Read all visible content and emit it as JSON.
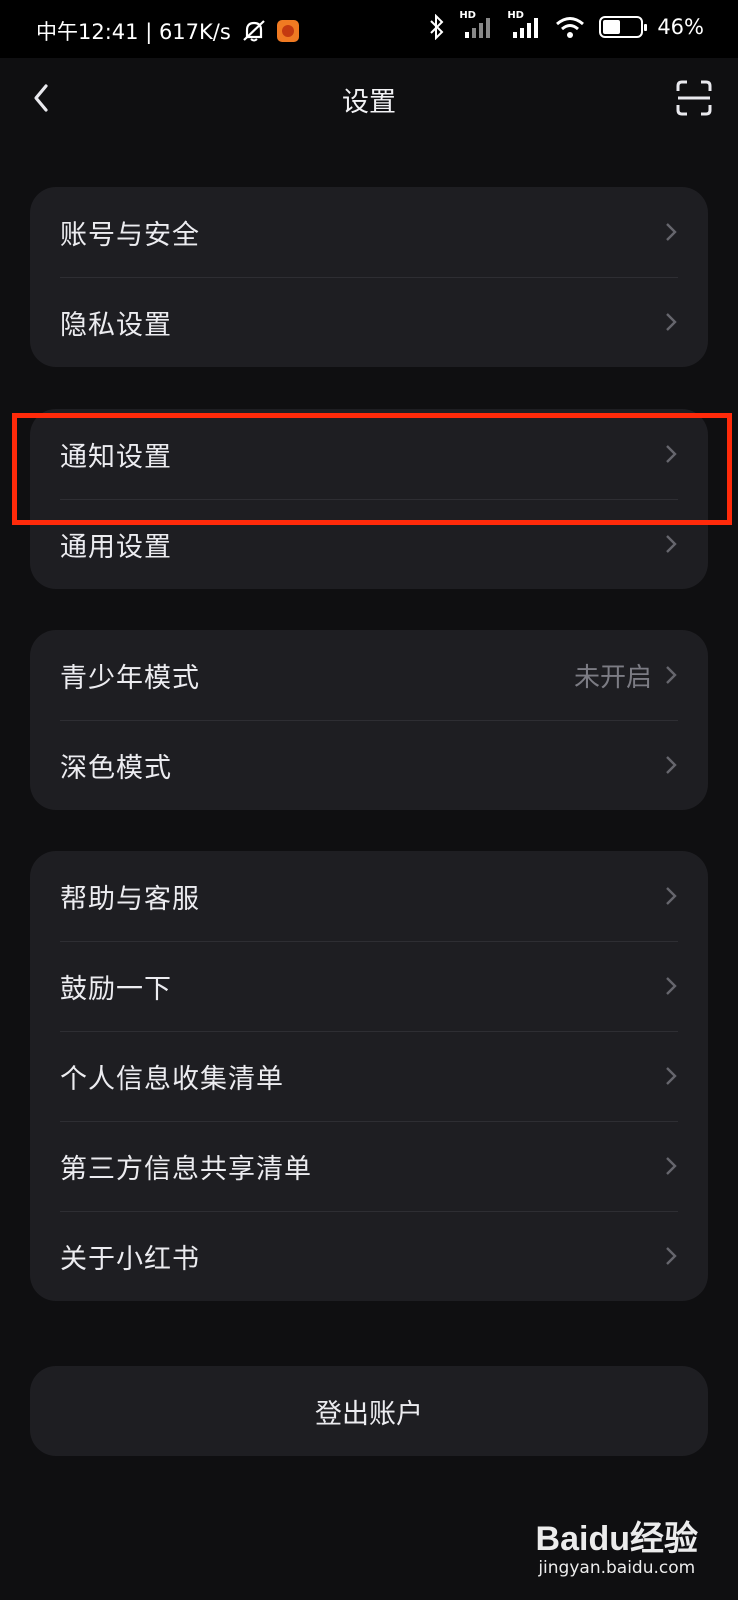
{
  "status_bar": {
    "time_speed": "中午12:41 | 617K/s",
    "battery": "46%",
    "battery_level": 0.46,
    "hd1": "HD",
    "hd2": "HD"
  },
  "nav": {
    "title": "设置",
    "back_icon": "chevron-left-icon",
    "scan_icon": "scan-icon"
  },
  "groups": [
    {
      "items": [
        {
          "label": "账号与安全"
        },
        {
          "label": "隐私设置"
        }
      ]
    },
    {
      "items": [
        {
          "label": "通知设置"
        },
        {
          "label": "通用设置"
        }
      ]
    },
    {
      "items": [
        {
          "label": "青少年模式",
          "value": "未开启"
        },
        {
          "label": "深色模式"
        }
      ]
    },
    {
      "items": [
        {
          "label": "帮助与客服"
        },
        {
          "label": "鼓励一下"
        },
        {
          "label": "个人信息收集清单"
        },
        {
          "label": "第三方信息共享清单"
        },
        {
          "label": "关于小红书"
        }
      ]
    }
  ],
  "logout_label": "登出账户",
  "highlight_color": "#ff2a0a",
  "watermark": {
    "logo_text": "Baidu经验",
    "url": "jingyan.baidu.com"
  }
}
